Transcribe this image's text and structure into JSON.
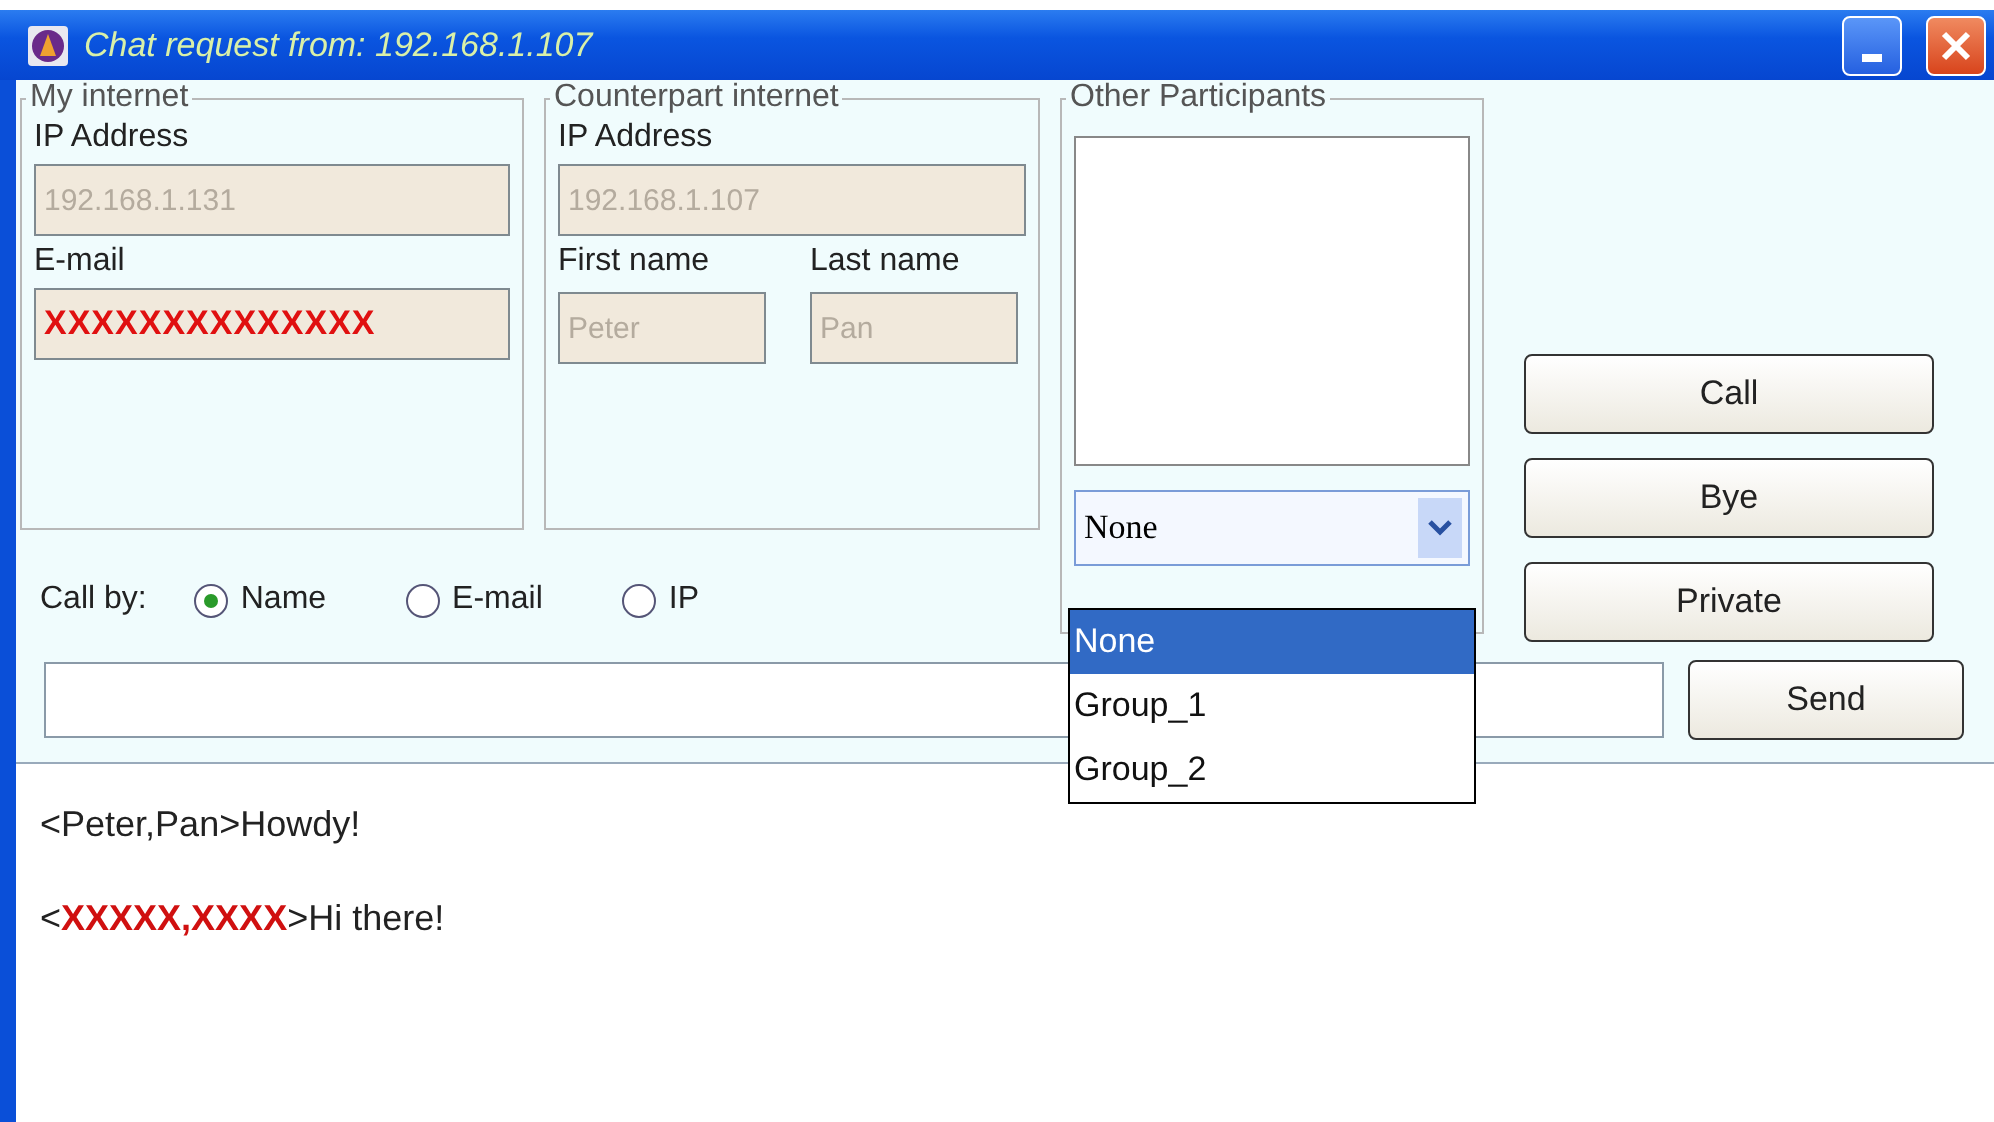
{
  "window": {
    "title": "Chat request from: 192.168.1.107"
  },
  "my_internet": {
    "title": "My internet",
    "ip_label": "IP Address",
    "ip_field": {
      "value": "192.168.1.131",
      "disabled": true
    },
    "email_label": "E-mail",
    "email_field": {
      "value": "XXXXXXXXXXXXXX",
      "disabled": true,
      "redacted": true
    }
  },
  "counterpart_internet": {
    "title": "Counterpart internet",
    "ip_label": "IP Address",
    "ip_field": {
      "value": "192.168.1.107",
      "disabled": true
    },
    "first_name_label": "First name",
    "last_name_label": "Last name",
    "first_name_field": {
      "value": "Peter",
      "disabled": true
    },
    "last_name_field": {
      "value": "Pan",
      "disabled": true
    }
  },
  "other_participants": {
    "title": "Other Participants",
    "group_select": {
      "value": "None",
      "expanded": true,
      "options": [
        {
          "label": "None",
          "selected": true
        },
        {
          "label": "Group_1",
          "selected": false
        },
        {
          "label": "Group_2",
          "selected": false
        }
      ]
    }
  },
  "call_by": {
    "label": "Call by:",
    "options": [
      {
        "label": "Name",
        "selected": true
      },
      {
        "label": "E-mail",
        "selected": false
      },
      {
        "label": "IP",
        "selected": false
      }
    ]
  },
  "buttons": [
    "Call",
    "Bye",
    "Private"
  ],
  "send_button": "Send",
  "messages": [
    {
      "before": "<",
      "sender": "Peter,Pan",
      "after": ">Howdy!",
      "redacted": false
    },
    {
      "before": "<",
      "sender": "XXXXX,XXXX",
      "after": ">Hi there!",
      "redacted": true
    }
  ]
}
